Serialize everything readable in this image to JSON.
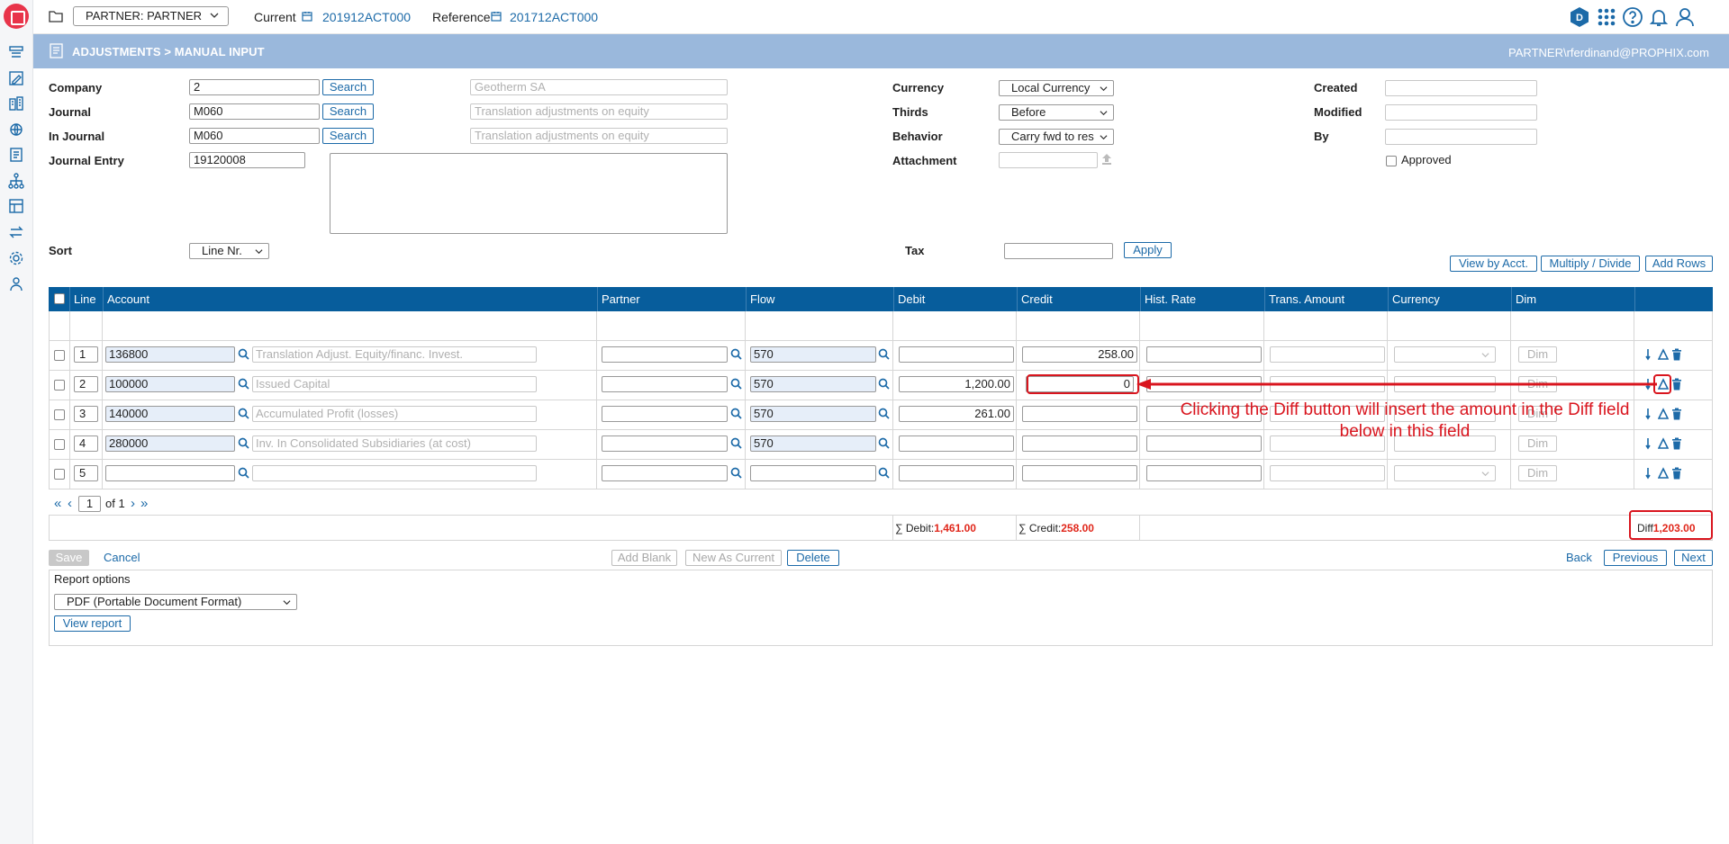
{
  "topbar": {
    "partner_select": "PARTNER: PARTNER",
    "current_label": "Current",
    "current_value": "201912ACT000",
    "reference_label": "Reference",
    "reference_value": "201712ACT000",
    "avatar_letter": "D"
  },
  "header": {
    "title": "ADJUSTMENTS > MANUAL INPUT",
    "user": "PARTNER\\rferdinand@PROPHIX.com"
  },
  "form": {
    "company": {
      "label": "Company",
      "value": "2",
      "button": "Search",
      "description": "Geotherm SA"
    },
    "journal": {
      "label": "Journal",
      "value": "M060",
      "button": "Search",
      "description": "Translation adjustments on equity"
    },
    "in_journal": {
      "label": "In Journal",
      "value": "M060",
      "button": "Search",
      "description": "Translation adjustments on equity"
    },
    "journal_entry": {
      "label": "Journal Entry",
      "value": "19120008"
    },
    "currency": {
      "label": "Currency",
      "value": "Local Currency"
    },
    "thirds": {
      "label": "Thirds",
      "value": "Before"
    },
    "behavior": {
      "label": "Behavior",
      "value": "Carry fwd to res"
    },
    "attachment": {
      "label": "Attachment"
    },
    "created": {
      "label": "Created"
    },
    "modified": {
      "label": "Modified"
    },
    "by": {
      "label": "By"
    },
    "approved": {
      "label": "Approved"
    },
    "sort": {
      "label": "Sort",
      "value": "Line Nr."
    },
    "tax": {
      "label": "Tax",
      "apply": "Apply"
    }
  },
  "grid_actions": {
    "view_by_acct": "View by Acct.",
    "multiply_divide": "Multiply / Divide",
    "add_rows": "Add Rows"
  },
  "grid": {
    "headers": [
      "Line",
      "Account",
      "Partner",
      "Flow",
      "Debit",
      "Credit",
      "Hist. Rate",
      "Trans. Amount",
      "Currency",
      "Dim"
    ],
    "dim_placeholder": "Dim",
    "rows": [
      {
        "line": "1",
        "account": "136800",
        "description": "Translation Adjust. Equity/financ. Invest.",
        "partner": "",
        "flow": "570",
        "debit": "",
        "credit": "258.00"
      },
      {
        "line": "2",
        "account": "100000",
        "description": "Issued Capital",
        "partner": "",
        "flow": "570",
        "debit": "1,200.00",
        "credit": "0"
      },
      {
        "line": "3",
        "account": "140000",
        "description": "Accumulated Profit (losses)",
        "partner": "",
        "flow": "570",
        "debit": "261.00",
        "credit": ""
      },
      {
        "line": "4",
        "account": "280000",
        "description": "Inv. In Consolidated Subsidiaries (at cost)",
        "partner": "",
        "flow": "570",
        "debit": "",
        "credit": ""
      },
      {
        "line": "5",
        "account": "",
        "description": "",
        "partner": "",
        "flow": "",
        "debit": "",
        "credit": ""
      }
    ],
    "pager": {
      "first": "«",
      "prev": "‹",
      "page": "1",
      "of": "of 1",
      "next": "›",
      "last": "»"
    },
    "totals": {
      "debit_label": "∑ Debit:",
      "debit_value": "1,461.00",
      "credit_label": "∑ Credit:",
      "credit_value": "258.00",
      "diff_label": "Diff",
      "diff_value": "1,203.00"
    }
  },
  "footer_actions": {
    "save": "Save",
    "cancel": "Cancel",
    "add_blank": "Add Blank",
    "new_as_current": "New As Current",
    "delete": "Delete",
    "back": "Back",
    "previous": "Previous",
    "next": "Next"
  },
  "report": {
    "title": "Report options",
    "format": "PDF (Portable Document Format)",
    "view_report": "View report"
  },
  "annotation": {
    "text": "Clicking the Diff button will insert the amount in the Diff field below in this field",
    "color": "#d9151e"
  },
  "colors": {
    "brand": "#e8344a",
    "link": "#1c6aa8",
    "grid_header": "#075d9c",
    "header_band": "#9ab8dc",
    "total_red": "#e0261a"
  }
}
